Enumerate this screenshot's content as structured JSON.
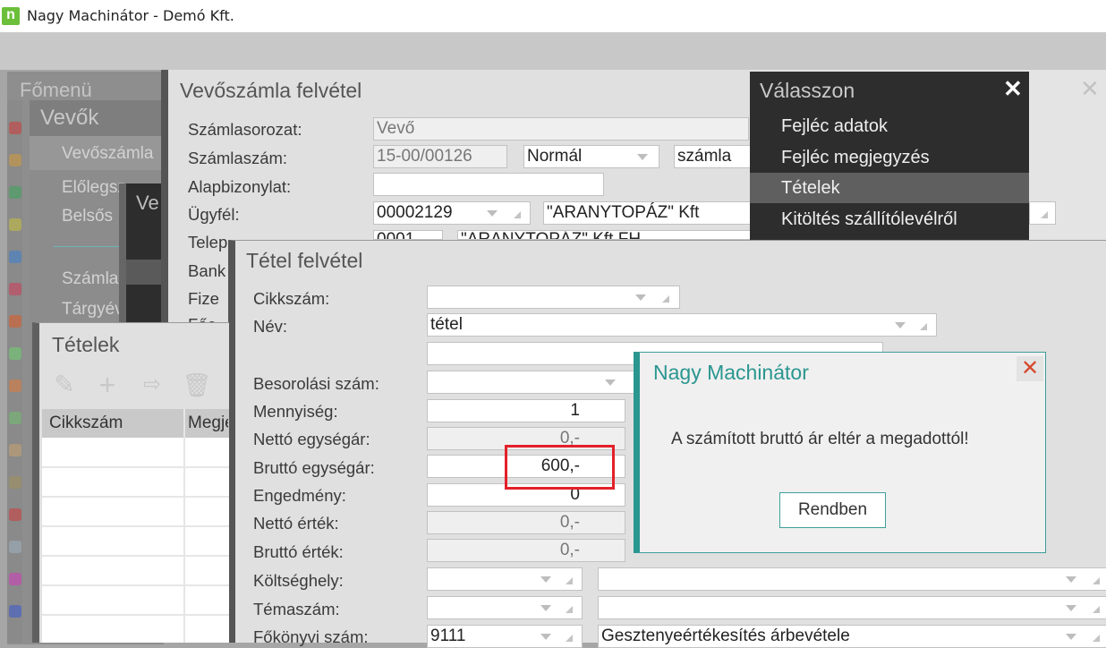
{
  "window": {
    "title": "Nagy Machinátor - Demó Kft.",
    "logo": "n"
  },
  "sidebar": {
    "main_menu": "Főmenü",
    "submenu_title": "Vevők",
    "items": [
      "Vevőszámla",
      "Előlegszámla",
      "Belsős",
      "Számla",
      "Tárgyév"
    ],
    "dark_panel_title": "Ve"
  },
  "invoice_window": {
    "title": "Vevőszámla felvétel",
    "fields": {
      "szamlasorozat": {
        "label": "Számlasorozat:",
        "value": "Vevő"
      },
      "szamlaszam": {
        "label": "Számlaszám:",
        "value": "15-00/00126",
        "type": "Normál",
        "kind": "számla"
      },
      "alapbizonylat": {
        "label": "Alapbizonylat:",
        "value": ""
      },
      "ugyfel": {
        "label": "Ügyfél:",
        "code": "00002129",
        "name": "\"ARANYTOPÁZ\" Kft"
      },
      "telephely": {
        "label": "Telephely:",
        "code": "0001",
        "name": "\"ARANYTOPÁZ\" Kft FH"
      },
      "bank": {
        "label": "Bank"
      },
      "fizetes": {
        "label": "Fize"
      },
      "fo": {
        "label": "Főe"
      }
    }
  },
  "choose_menu": {
    "title": "Válasszon",
    "items": [
      "Fejléc adatok",
      "Fejléc megjegyzés",
      "Tételek",
      "Kitöltés szállítólevélről"
    ],
    "selected": "Tételek"
  },
  "items_panel": {
    "title": "Tételek",
    "columns": [
      "Cikkszám",
      "Megjegyzés"
    ],
    "toolbar": [
      "pencil-icon",
      "plus-icon",
      "import-icon",
      "trash-icon"
    ]
  },
  "item_window": {
    "title": "Tétel felvétel",
    "fields": {
      "cikkszam": {
        "label": "Cikkszám:",
        "value": ""
      },
      "nev": {
        "label": "Név:",
        "value": "tétel"
      },
      "besorolasi": {
        "label": "Besorolási szám:",
        "value": ""
      },
      "mennyiseg": {
        "label": "Mennyiség:",
        "value": "1"
      },
      "netto_egysegar": {
        "label": "Nettó egységár:",
        "value": "0,-"
      },
      "brutto_egysegar": {
        "label": "Bruttó egységár:",
        "value": "600,-"
      },
      "engedmeny": {
        "label": "Engedmény:",
        "value": "0"
      },
      "netto_ertek": {
        "label": "Nettó érték:",
        "value": "0,-"
      },
      "brutto_ertek": {
        "label": "Bruttó érték:",
        "value": "0,-"
      },
      "koltseghely": {
        "label": "Költséghely:",
        "value": ""
      },
      "temaszam": {
        "label": "Témaszám:",
        "value": ""
      },
      "fokonyvi": {
        "label": "Főkönyvi szám:",
        "value": "9111",
        "name": "Gesztenyeértékesítés árbevétele"
      }
    }
  },
  "dialog": {
    "title": "Nagy Machinátor",
    "message": "A számított bruttó ár eltér a megadottól!",
    "ok_label": "Rendben",
    "close": "✕"
  },
  "colors": {
    "accent": "#2a9690",
    "highlight": "#e3202a"
  }
}
